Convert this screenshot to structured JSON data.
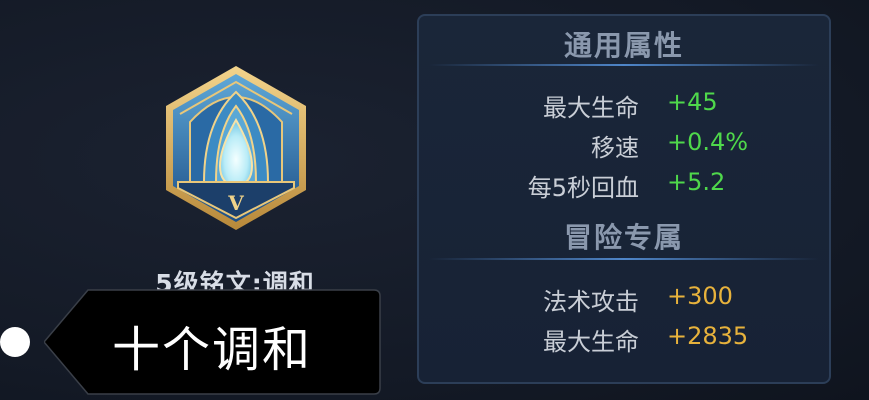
{
  "inscription": {
    "icon": "harmony-inscription-emblem-icon",
    "level_numeral": "V",
    "name": "5级铭文:调和"
  },
  "stats_panel": {
    "general_title": "通用属性",
    "general_stats": [
      {
        "label": "最大生命",
        "value": "+45"
      },
      {
        "label": "移速",
        "value": "+0.4%"
      },
      {
        "label": "每5秒回血",
        "value": "+5.2"
      }
    ],
    "adventure_title": "冒险专属",
    "adventure_stats": [
      {
        "label": "法术攻击",
        "value": "+300"
      },
      {
        "label": "最大生命",
        "value": "+2835"
      }
    ]
  },
  "tooltip": {
    "text": "十个调和"
  },
  "colors": {
    "general_value": "#4fd84b",
    "adventure_value": "#e7b23c",
    "panel_border": "#2c3e58"
  }
}
